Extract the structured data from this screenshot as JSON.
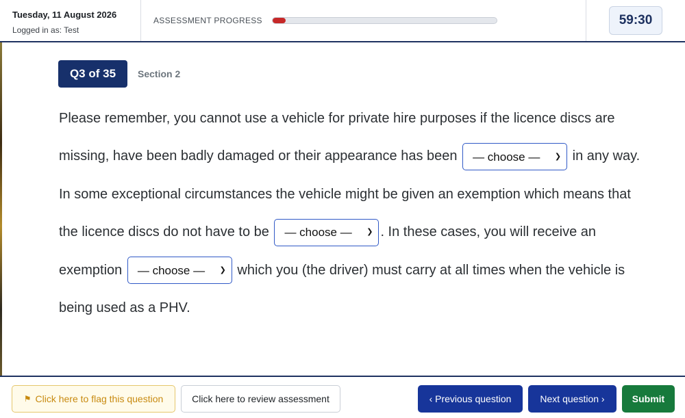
{
  "header": {
    "date": "Tuesday, 11 August 2026",
    "logged_in": "Logged in as: Test",
    "progress_label": "ASSESSMENT PROGRESS",
    "progress_fraction": 0.06,
    "progress_color": "#c62828",
    "timer": "59:30"
  },
  "question": {
    "badge": "Q3 of 35",
    "section": "Section 2",
    "text_1": "Please remember, you cannot use a vehicle for private hire purposes if the licence discs are missing, have been badly damaged or their appearance has been",
    "text_2": "in any way. In some exceptional circumstances the vehicle might be given an exemption which means that the licence discs do not have to be",
    "text_3": ". In these cases, you will receive an exemption",
    "text_4": "which you (the driver) must carry at all times when the vehicle is being used as a PHV.",
    "select_1": "— choose —",
    "select_2": "— choose —",
    "select_3": "— choose —"
  },
  "footer": {
    "flag_label": "Click here to flag this question",
    "review_label": "Click here to review assessment",
    "prev_label": "‹ Previous question",
    "next_label": "Next question ›",
    "submit_label": "Submit"
  },
  "colors": {
    "primary": "#17359a",
    "navy": "#17306b",
    "success": "#177a3c",
    "warning": "#c88a10"
  },
  "icons": {
    "flag": "flag-icon",
    "select_chevron": "chevron-down-icon"
  }
}
